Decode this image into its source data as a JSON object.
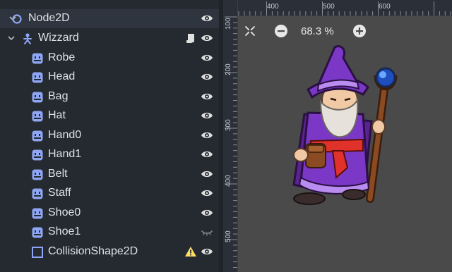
{
  "scene_tree": {
    "nodes": [
      {
        "label": "Node2D",
        "icon": "node2d-circle-icon"
      },
      {
        "label": "Wizzard",
        "icon": "skeleton-icon"
      },
      {
        "label": "Robe",
        "icon": "sprite2d-icon"
      },
      {
        "label": "Head",
        "icon": "sprite2d-icon"
      },
      {
        "label": "Bag",
        "icon": "sprite2d-icon"
      },
      {
        "label": "Hat",
        "icon": "sprite2d-icon"
      },
      {
        "label": "Hand0",
        "icon": "sprite2d-icon"
      },
      {
        "label": "Hand1",
        "icon": "sprite2d-icon"
      },
      {
        "label": "Belt",
        "icon": "sprite2d-icon"
      },
      {
        "label": "Staff",
        "icon": "sprite2d-icon"
      },
      {
        "label": "Shoe0",
        "icon": "sprite2d-icon"
      },
      {
        "label": "Shoe1",
        "icon": "sprite2d-icon"
      },
      {
        "label": "CollisionShape2D",
        "icon": "collision-shape-icon"
      }
    ]
  },
  "viewport": {
    "zoom_label": "68.3 %",
    "ruler_top_labels": [
      "400",
      "500",
      "600"
    ],
    "ruler_left_labels": [
      "100",
      "200",
      "300",
      "400",
      "500"
    ]
  },
  "colors": {
    "node_icon": "#8da5f3",
    "sprite_icon": "#8da5f3",
    "warning": "#ffdd65",
    "panel_bg": "#252a31",
    "viewport_bg": "#4a4a4a"
  }
}
